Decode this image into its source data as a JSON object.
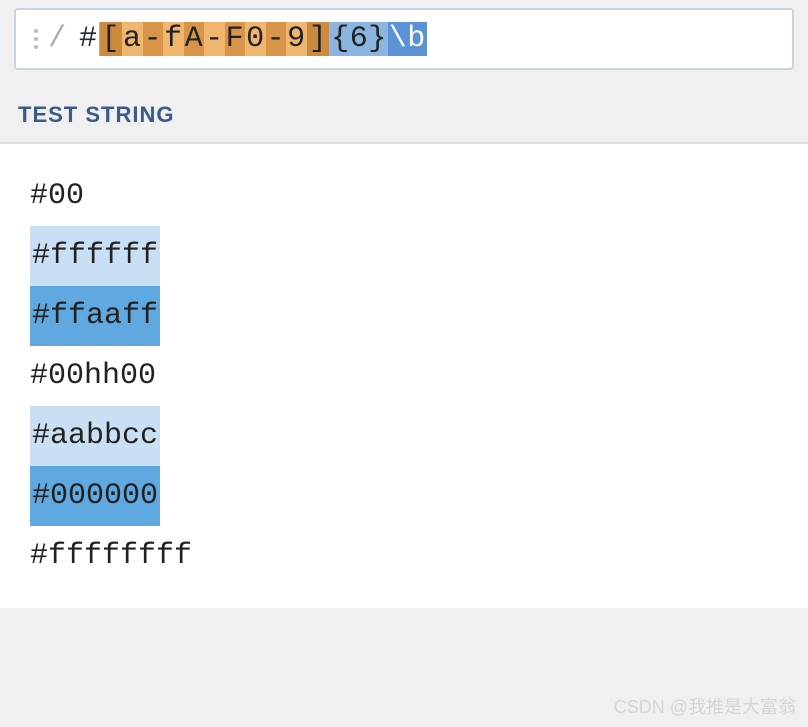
{
  "regex": {
    "delimiter": "/",
    "prefix": "#",
    "charclass_open": "[",
    "charclass_body": [
      "a",
      "-",
      "f",
      "A",
      "-",
      "F",
      "0",
      "-",
      "9"
    ],
    "charclass_close": "]",
    "quantifier": "{6}",
    "anchor": "\\b"
  },
  "section_title": "TEST STRING",
  "test_lines": [
    {
      "text": "#00",
      "matched": false
    },
    {
      "text": "#ffffff",
      "matched": true,
      "highlight": "light"
    },
    {
      "text": "#ffaaff",
      "matched": true,
      "highlight": "dark"
    },
    {
      "text": "#00hh00",
      "matched": false
    },
    {
      "text": "#aabbcc",
      "matched": true,
      "highlight": "light"
    },
    {
      "text": "#000000",
      "matched": true,
      "highlight": "dark"
    },
    {
      "text": "#ffffffff",
      "matched": false
    }
  ],
  "watermark": "CSDN @我推是大富翁"
}
